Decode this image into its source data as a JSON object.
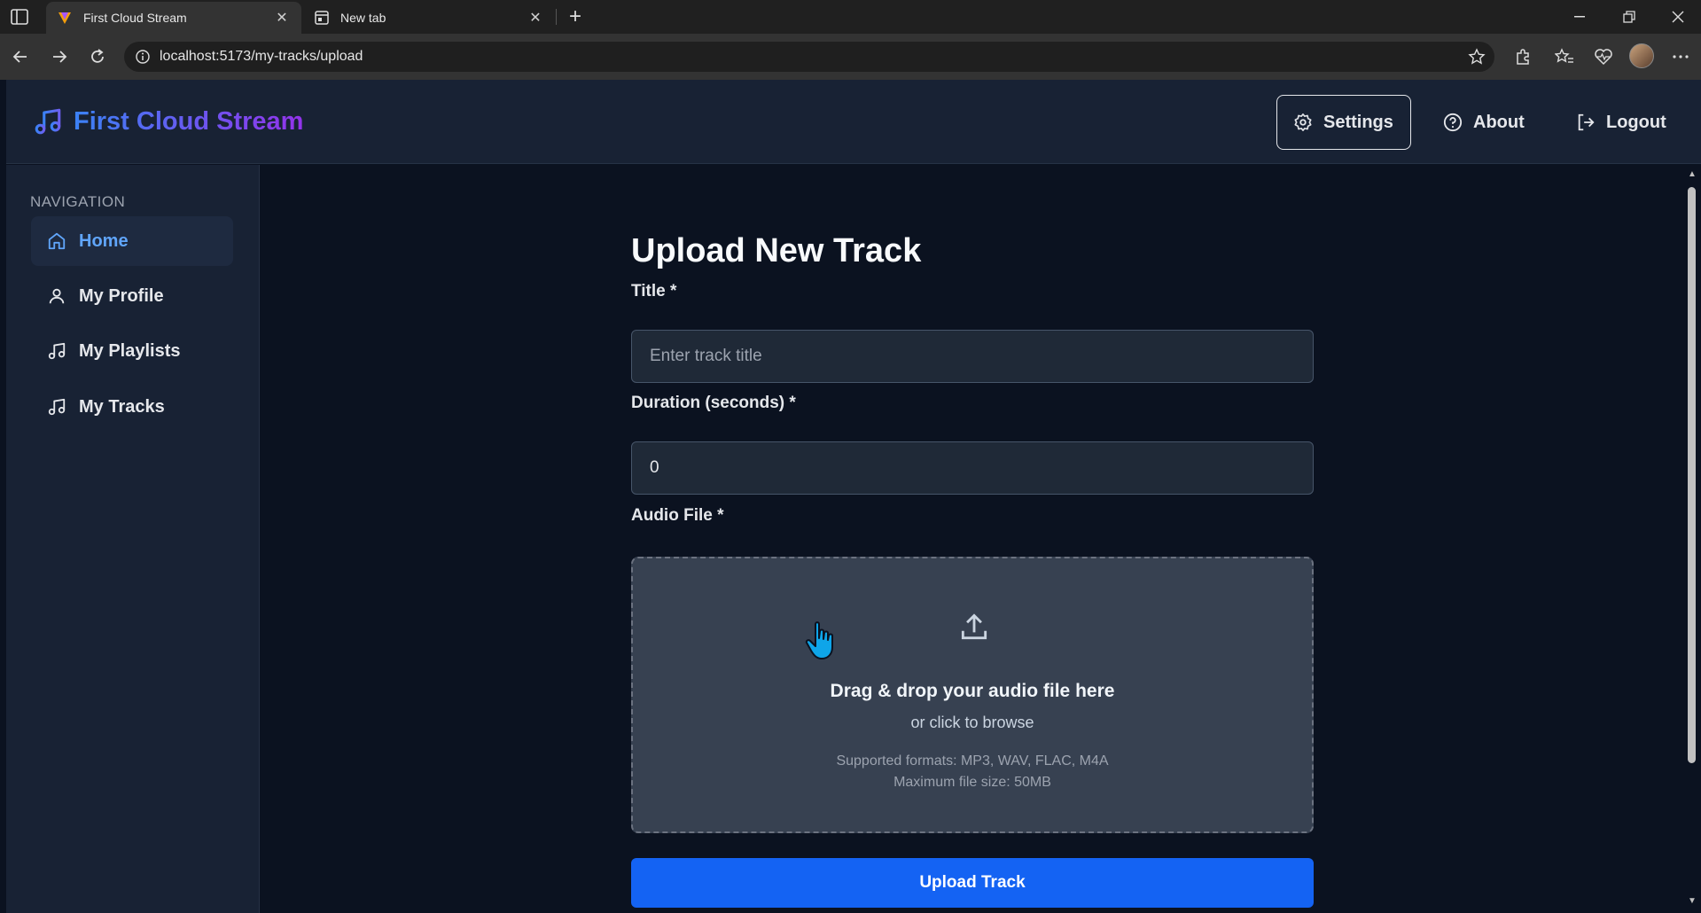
{
  "browser": {
    "tabs": [
      {
        "title": "First Cloud Stream",
        "active": true,
        "icon": "app-favicon"
      },
      {
        "title": "New tab",
        "active": false,
        "icon": "new-tab-icon"
      }
    ],
    "url": "localhost:5173/my-tracks/upload"
  },
  "header": {
    "brand": "First Cloud Stream",
    "brand_icon": "music-note-icon",
    "settings_label": "Settings",
    "about_label": "About",
    "logout_label": "Logout",
    "brand_gradient": [
      "#3b82f6",
      "#9333ea"
    ]
  },
  "sidebar": {
    "heading": "NAVIGATION",
    "items": [
      {
        "label": "Home",
        "icon": "home-icon",
        "active": true
      },
      {
        "label": "My Profile",
        "icon": "user-icon",
        "active": false
      },
      {
        "label": "My Playlists",
        "icon": "music-note-icon",
        "active": false
      },
      {
        "label": "My Tracks",
        "icon": "music-note-icon",
        "active": false
      }
    ]
  },
  "form": {
    "title": "Upload New Track",
    "title_label": "Title *",
    "title_placeholder": "Enter track title",
    "title_value": "",
    "duration_label": "Duration (seconds) *",
    "duration_value": "0",
    "audio_label": "Audio File *",
    "dropzone": {
      "main": "Drag & drop your audio file here",
      "sub": "or click to browse",
      "formats": "Supported formats: MP3, WAV, FLAC, M4A",
      "max_size": "Maximum file size: 50MB"
    },
    "submit_label": "Upload Track"
  },
  "colors": {
    "accent": "#1463f3",
    "active_nav": "#60a5fa",
    "panel": "#182234",
    "background": "#0b1220"
  }
}
